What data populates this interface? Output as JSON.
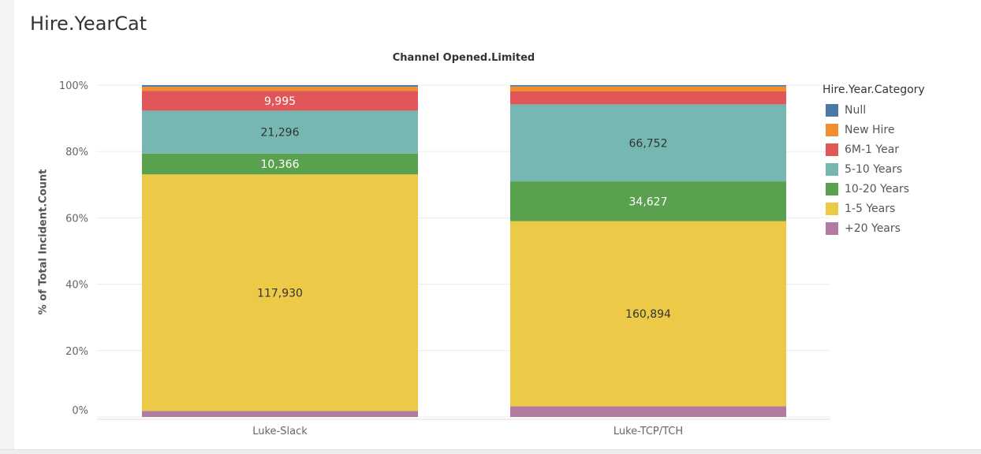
{
  "dashboard": {
    "title": "Hire.YearCat"
  },
  "chart_data": {
    "type": "bar",
    "stacked": "100%",
    "column_header": "Channel Opened.Limited",
    "ylabel": "% of Total Incident.Count",
    "xlabel": "",
    "ylim": [
      0,
      100
    ],
    "y_ticks": [
      "100%",
      "80%",
      "60%",
      "40%",
      "20%",
      "0%"
    ],
    "categories": [
      "Luke-Slack",
      "Luke-TCP/TCH"
    ],
    "legend_title": "Hire.Year.Category",
    "legend_position": "right",
    "grid": true,
    "series": [
      {
        "name": "+20 Years",
        "color": "#b07aa1",
        "values_pct": [
          1.8,
          3.2
        ],
        "labels": [
          "",
          ""
        ]
      },
      {
        "name": "1-5 Years",
        "color": "#edc948",
        "values_pct": [
          71.3,
          55.8
        ],
        "labels": [
          "117,930",
          "160,894"
        ]
      },
      {
        "name": "10-20 Years",
        "color": "#59a14f",
        "values_pct": [
          6.3,
          12.0
        ],
        "labels": [
          "10,366",
          "34,627"
        ]
      },
      {
        "name": "5-10 Years",
        "color": "#76b7b2",
        "values_pct": [
          12.9,
          23.2
        ],
        "labels": [
          "21,296",
          "66,752"
        ]
      },
      {
        "name": "6M-1 Year",
        "color": "#e15759",
        "values_pct": [
          6.0,
          3.9
        ],
        "labels": [
          "9,995",
          ""
        ]
      },
      {
        "name": "New Hire",
        "color": "#f28e2b",
        "values_pct": [
          1.2,
          1.5
        ],
        "labels": [
          "",
          ""
        ]
      },
      {
        "name": "Null",
        "color": "#4e79a7",
        "values_pct": [
          0.5,
          0.4
        ],
        "labels": [
          "",
          ""
        ]
      }
    ],
    "label_colors": {
      "+20 Years": "#333333",
      "1-5 Years": "#333333",
      "10-20 Years": "#ffffff",
      "5-10 Years": "#333333",
      "6M-1 Year": "#ffffff",
      "New Hire": "#333333",
      "Null": "#ffffff"
    }
  },
  "legend": {
    "title": "Hire.Year.Category",
    "items": [
      {
        "label": "Null",
        "color": "#4e79a7"
      },
      {
        "label": "New Hire",
        "color": "#f28e2b"
      },
      {
        "label": "6M-1 Year",
        "color": "#e15759"
      },
      {
        "label": "5-10 Years",
        "color": "#76b7b2"
      },
      {
        "label": "10-20 Years",
        "color": "#59a14f"
      },
      {
        "label": "1-5 Years",
        "color": "#edc948"
      },
      {
        "label": "+20 Years",
        "color": "#b07aa1"
      }
    ]
  }
}
